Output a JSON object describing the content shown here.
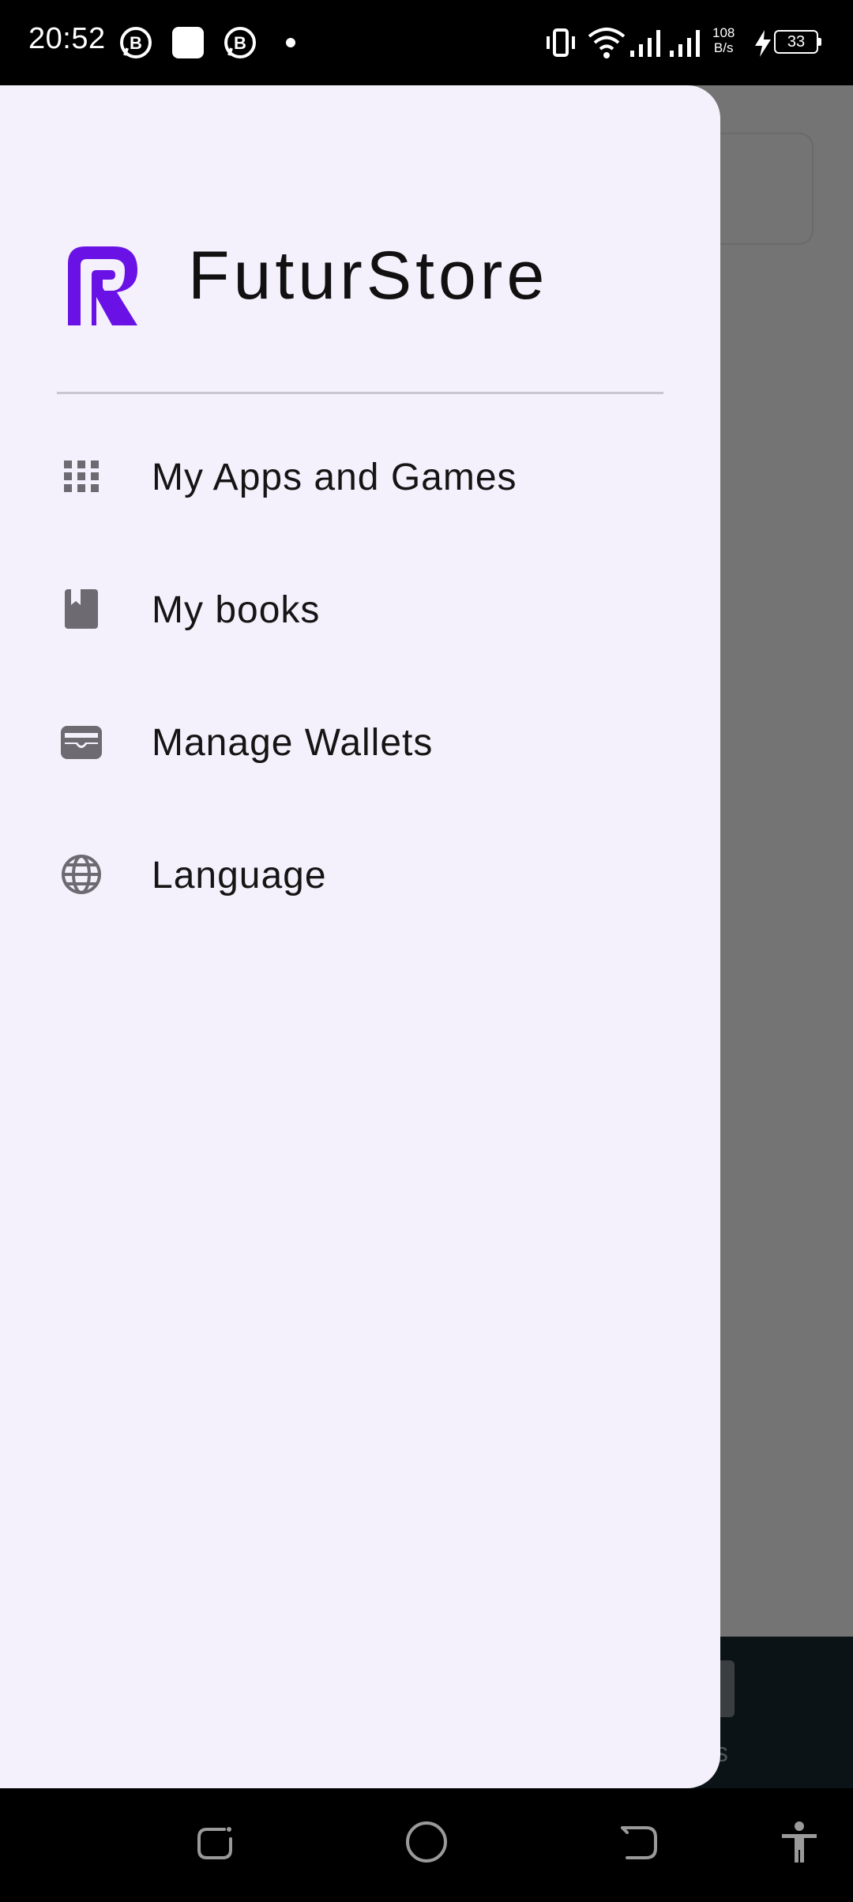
{
  "status_bar": {
    "time": "20:52",
    "network_speed_value": "108",
    "network_speed_unit": "B/s",
    "battery": "33"
  },
  "drawer": {
    "app_title": "FuturStore",
    "logo_color": "#6a12e6",
    "menu": [
      {
        "label": "My Apps and Games",
        "icon": "apps-grid-icon"
      },
      {
        "label": "My books",
        "icon": "book-icon"
      },
      {
        "label": "Manage Wallets",
        "icon": "wallet-icon"
      },
      {
        "label": "Language",
        "icon": "globe-icon"
      }
    ]
  },
  "background": {
    "bottom_tab_label_partial": "ks"
  },
  "nav_bar": {
    "buttons": [
      "recents",
      "home",
      "back",
      "accessibility"
    ]
  }
}
